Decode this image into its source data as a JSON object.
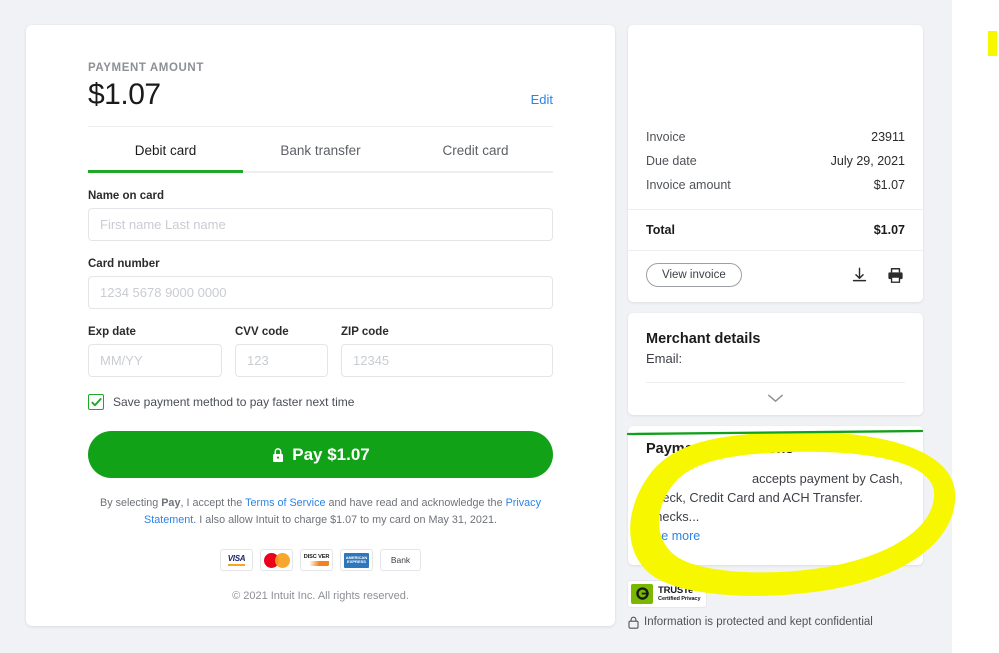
{
  "payment": {
    "amount_label": "PAYMENT AMOUNT",
    "amount_value": "$1.07",
    "edit_label": "Edit",
    "tabs": [
      {
        "label": "Debit card",
        "active": true
      },
      {
        "label": "Bank transfer",
        "active": false
      },
      {
        "label": "Credit card",
        "active": false
      }
    ],
    "fields": {
      "name_label": "Name on card",
      "name_placeholder": "First name Last name",
      "name_value": "",
      "card_label": "Card number",
      "card_placeholder": "1234 5678 9000 0000",
      "card_value": "",
      "exp_label": "Exp date",
      "exp_placeholder": "MM/YY",
      "exp_value": "",
      "cvv_label": "CVV code",
      "cvv_placeholder": "123",
      "cvv_value": "",
      "zip_label": "ZIP code",
      "zip_placeholder": "12345",
      "zip_value": ""
    },
    "save_method_label": "Save payment method to pay faster next time",
    "save_method_checked": true,
    "pay_button_label": "Pay $1.07",
    "legal": {
      "part1": "By selecting ",
      "pay_word": "Pay",
      "part2": ", I accept the ",
      "terms_link": "Terms of Service",
      "part3": " and have read and acknowledge the ",
      "privacy_link": "Privacy Statement",
      "part4": ". I also allow Intuit to charge $1.07 to my card on May 31, 2021."
    },
    "card_logos": [
      {
        "name": "visa-logo",
        "text": "VISA"
      },
      {
        "name": "mastercard-logo",
        "text": ""
      },
      {
        "name": "discover-logo",
        "text": "DISC VER"
      },
      {
        "name": "amex-logo",
        "text": "AMERICAN EXPRESS"
      },
      {
        "name": "bank-logo",
        "text": "Bank"
      }
    ],
    "copyright": "© 2021 Intuit Inc. All rights reserved."
  },
  "sidebar": {
    "invoice_rows": [
      {
        "label": "Invoice",
        "value": "23911"
      },
      {
        "label": "Due date",
        "value": "July 29, 2021"
      },
      {
        "label": "Invoice amount",
        "value": "$1.07"
      }
    ],
    "total_label": "Total",
    "total_value": "$1.07",
    "view_invoice_label": "View invoice",
    "merchant": {
      "title": "Merchant details",
      "email_label": "Email:",
      "email_value": ""
    },
    "instructions": {
      "title": "Payment instructions",
      "body": "accepts payment by Cash, Check, Credit Card and ACH Transfer. Checks...",
      "see_more_label": "See more"
    },
    "truste": {
      "line1": "TRUSTe",
      "line2": "Certified Privacy"
    },
    "confidential_text": "Information is protected and kept confidential"
  },
  "colors": {
    "brand_green": "#11a217",
    "tab_underline_green": "#1fa828",
    "link_blue": "#2b84e5",
    "page_bg": "#f1f2f5",
    "highlighter_yellow": "#f7f700",
    "annotation_green": "#12a019"
  }
}
